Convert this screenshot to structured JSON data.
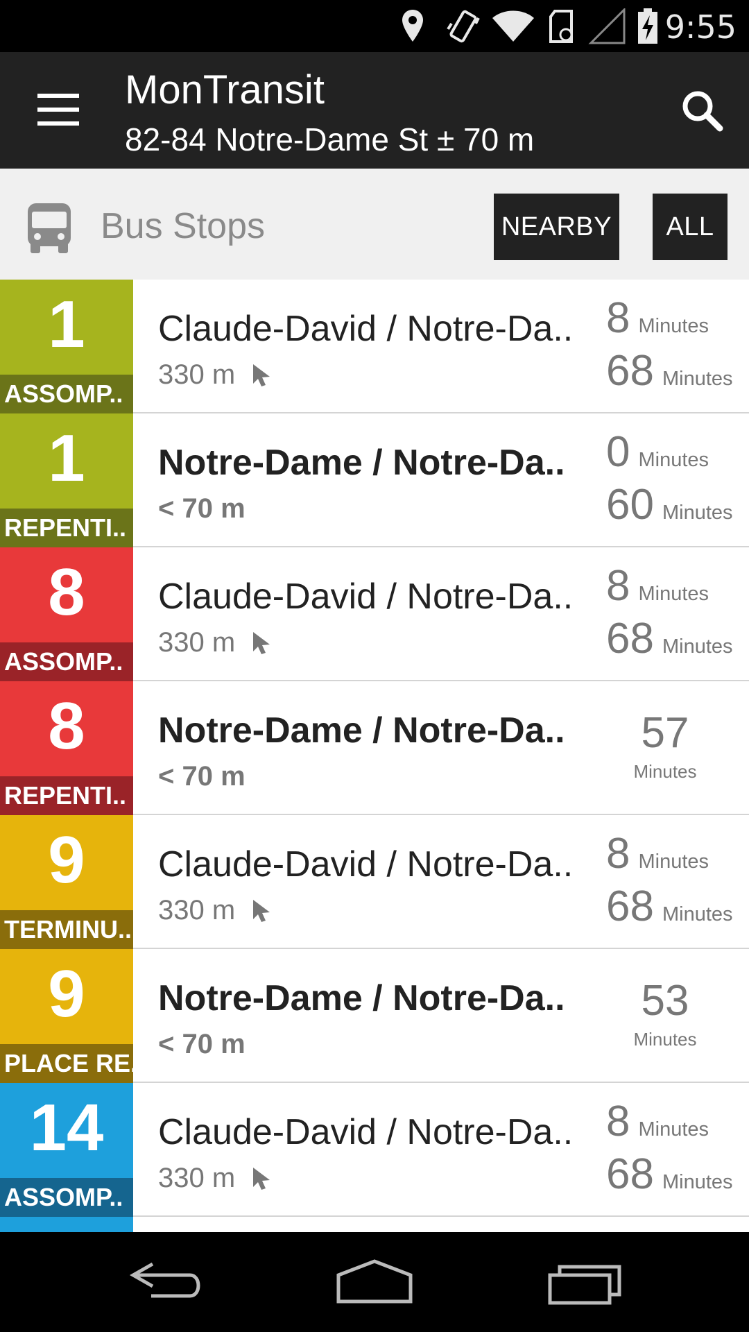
{
  "status_bar": {
    "time": "9:55",
    "icons": [
      "location-icon",
      "vibrate-icon",
      "wifi-icon",
      "sd-card-icon",
      "signal-icon",
      "battery-charging-icon"
    ]
  },
  "action_bar": {
    "title": "MonTransit",
    "subtitle": "82-84 Notre-Dame St ± 70 m",
    "menu_icon": "hamburger-menu-icon",
    "search_icon": "search-icon"
  },
  "section": {
    "icon": "bus-icon",
    "title": "Bus Stops",
    "buttons": {
      "nearby": "NEARBY",
      "all": "ALL"
    }
  },
  "stops": [
    {
      "route": "1",
      "direction": "ASSOMP..",
      "color": "#A6B41E",
      "dir_color": "#6B7419",
      "name": "Claude-David / Notre-Da..",
      "bold": false,
      "distance": "330 m",
      "compass": true,
      "times": [
        {
          "n": "8",
          "u": "Minutes"
        },
        {
          "n": "68",
          "u": "Minutes"
        }
      ]
    },
    {
      "route": "1",
      "direction": "REPENTI..",
      "color": "#A6B41E",
      "dir_color": "#6B7419",
      "name": "Notre-Dame / Notre-Da..",
      "bold": true,
      "distance": "< 70 m",
      "compass": false,
      "times": [
        {
          "n": "0",
          "u": "Minutes"
        },
        {
          "n": "60",
          "u": "Minutes"
        }
      ]
    },
    {
      "route": "8",
      "direction": "ASSOMP..",
      "color": "#E8393A",
      "dir_color": "#9A2328",
      "name": "Claude-David / Notre-Da..",
      "bold": false,
      "distance": "330 m",
      "compass": true,
      "times": [
        {
          "n": "8",
          "u": "Minutes"
        },
        {
          "n": "68",
          "u": "Minutes"
        }
      ]
    },
    {
      "route": "8",
      "direction": "REPENTI..",
      "color": "#E8393A",
      "dir_color": "#9A2328",
      "name": "Notre-Dame / Notre-Da..",
      "bold": true,
      "distance": "< 70 m",
      "compass": false,
      "times": [
        {
          "n": "57",
          "u": "Minutes"
        }
      ]
    },
    {
      "route": "9",
      "direction": "TERMINU..",
      "color": "#E6B40C",
      "dir_color": "#8A6D0B",
      "name": "Claude-David / Notre-Da..",
      "bold": false,
      "distance": "330 m",
      "compass": true,
      "times": [
        {
          "n": "8",
          "u": "Minutes"
        },
        {
          "n": "68",
          "u": "Minutes"
        }
      ]
    },
    {
      "route": "9",
      "direction": "PLACE RE..",
      "color": "#E6B40C",
      "dir_color": "#8A6D0B",
      "name": "Notre-Dame / Notre-Da..",
      "bold": true,
      "distance": "< 70 m",
      "compass": false,
      "times": [
        {
          "n": "53",
          "u": "Minutes"
        }
      ]
    },
    {
      "route": "14",
      "direction": "ASSOMP..",
      "color": "#1EA0DC",
      "dir_color": "#15658F",
      "name": "Claude-David / Notre-Da..",
      "bold": false,
      "distance": "330 m",
      "compass": true,
      "times": [
        {
          "n": "8",
          "u": "Minutes"
        },
        {
          "n": "68",
          "u": "Minutes"
        }
      ]
    }
  ],
  "nav_bar": {
    "icons": [
      "back-icon",
      "home-icon",
      "recents-icon"
    ]
  }
}
